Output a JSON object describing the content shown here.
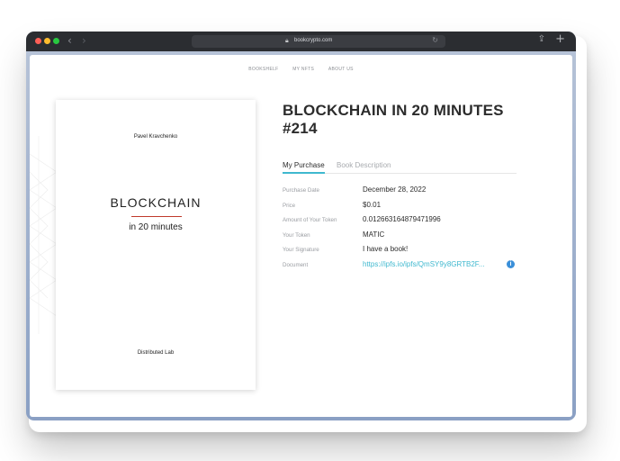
{
  "browser": {
    "url": "bookcrypto.com",
    "nav_back": "‹",
    "nav_forward": "›",
    "lock_icon": "lock-icon",
    "reload_icon": "reload-icon",
    "share_icon": "share-icon",
    "new_tab_icon": "plus-icon"
  },
  "nav": {
    "items": [
      "BOOKSHELF",
      "MY NFTS",
      "ABOUT US"
    ]
  },
  "cover": {
    "author": "Pavel Kravchenko",
    "title": "BLOCKCHAIN",
    "subtitle": "in 20 minutes",
    "publisher": "Distributed Lab"
  },
  "book": {
    "title_line1": "BLOCKCHAIN IN 20 MINUTES",
    "title_line2": "#214"
  },
  "tabs": {
    "purchase": "My Purchase",
    "description": "Book Description"
  },
  "purchase": {
    "rows": [
      {
        "label": "Purchase Date",
        "value": "December 28, 2022"
      },
      {
        "label": "Price",
        "value": "$0.01"
      },
      {
        "label": "Amount of Your Token",
        "value": "0.012663164879471996"
      },
      {
        "label": "Your Token",
        "value": "MATIC"
      },
      {
        "label": "Your Signature",
        "value": "I have a book!"
      },
      {
        "label": "Document",
        "value": "https://ipfs.io/ipfs/QmSY9y8GRTB2F..."
      }
    ],
    "info_icon": "i"
  },
  "colors": {
    "accent": "#3fb8cf",
    "cover_rule": "#c0392b",
    "titlebar": "#2b2d31",
    "info": "#3a8fd9"
  }
}
